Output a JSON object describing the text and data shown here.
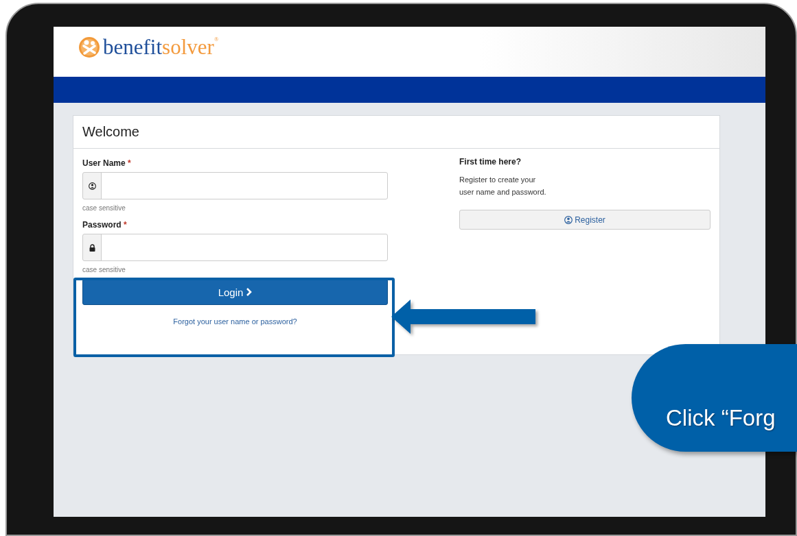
{
  "logo": {
    "word_main": "benefit",
    "word_accent": "solver",
    "mark": "®"
  },
  "card": {
    "title": "Welcome"
  },
  "fields": [
    {
      "kind": "user",
      "label": "User Name",
      "required_mark": "*",
      "hint": "case sensitive"
    },
    {
      "kind": "password",
      "label": "Password",
      "required_mark": "*",
      "hint": "case sensitive"
    }
  ],
  "login_button": {
    "label": "Login"
  },
  "forgot_link": "Forgot your user name or password?",
  "register": {
    "heading": "First time here?",
    "text": "Register to create your user name and password.",
    "button": "Register"
  },
  "callout": {
    "text": "Click “Forg"
  }
}
